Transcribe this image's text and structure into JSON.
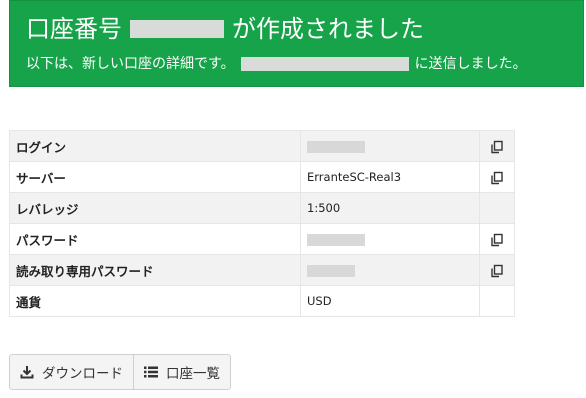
{
  "banner": {
    "title_prefix": "口座番号",
    "title_suffix": "が作成されました",
    "subtitle_prefix": "以下は、新しい口座の詳細です。",
    "subtitle_suffix": "に送信しました。",
    "background_color": "#17a349"
  },
  "details": {
    "rows": [
      {
        "label": "ログイン",
        "value": null,
        "redacted": true,
        "copyable": true
      },
      {
        "label": "サーバー",
        "value": "ErranteSC-Real3",
        "redacted": false,
        "copyable": true
      },
      {
        "label": "レバレッジ",
        "value": "1:500",
        "redacted": false,
        "copyable": false
      },
      {
        "label": "パスワード",
        "value": null,
        "redacted": true,
        "copyable": true
      },
      {
        "label": "読み取り専用パスワード",
        "value": null,
        "redacted": true,
        "copyable": true
      },
      {
        "label": "通貨",
        "value": "USD",
        "redacted": false,
        "copyable": false
      }
    ]
  },
  "actions": {
    "download_label": "ダウンロード",
    "download_icon": "download-icon",
    "account_list_label": "口座一覧",
    "account_list_icon": "list-icon"
  }
}
